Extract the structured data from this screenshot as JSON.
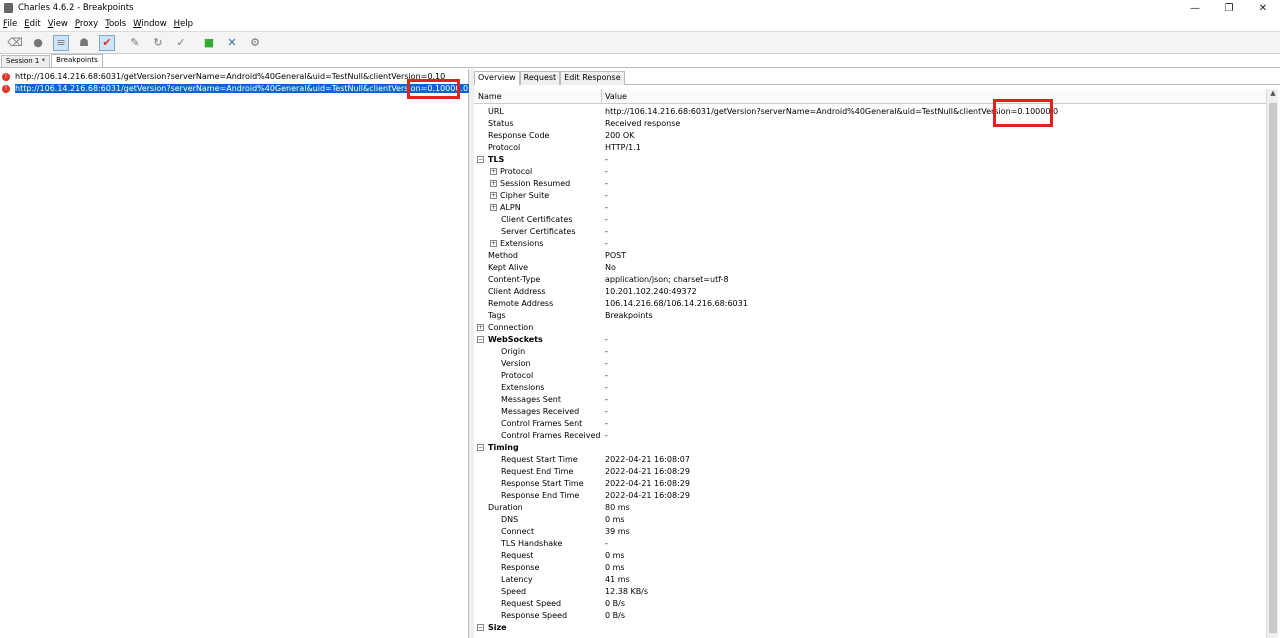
{
  "window": {
    "title": "Charles 4.6.2 - Breakpoints",
    "minimize": "—",
    "restore": "❐",
    "close": "✕"
  },
  "menu": [
    "File",
    "Edit",
    "View",
    "Proxy",
    "Tools",
    "Window",
    "Help"
  ],
  "menu_access": [
    "F",
    "E",
    "V",
    "P",
    "T",
    "W",
    "H"
  ],
  "session_tabs": [
    "Session 1 *",
    "Breakpoints"
  ],
  "requests": [
    {
      "url": "http://106.14.216.68:6031/getVersion?serverName=Android%40General&uid=TestNull&clientVersion=",
      "version": "0.10"
    },
    {
      "url": "http://106.14.216.68:6031/getVersion?serverName=Android%40General&uid=TestNull&clientVersion=",
      "version": "0.10000.0"
    }
  ],
  "detail_tabs": [
    "Overview",
    "Request",
    "Edit Response"
  ],
  "columns": {
    "name": "Name",
    "value": "Value"
  },
  "overview_url": {
    "prefix": "http://106.14.216.68:6031/getVersion?serverName=Android%40General&uid=TestNull&clientVersion=",
    "version": "0.10000.0"
  },
  "rows": [
    {
      "n": "URL",
      "v": ""
    },
    {
      "n": "Status",
      "v": "Received response"
    },
    {
      "n": "Response Code",
      "v": "200 OK"
    },
    {
      "n": "Protocol",
      "v": "HTTP/1.1"
    },
    {
      "n": "TLS",
      "v": "-"
    },
    {
      "n": "Protocol",
      "v": "-"
    },
    {
      "n": "Session Resumed",
      "v": "-"
    },
    {
      "n": "Cipher Suite",
      "v": "-"
    },
    {
      "n": "ALPN",
      "v": "-"
    },
    {
      "n": "Client Certificates",
      "v": "-"
    },
    {
      "n": "Server Certificates",
      "v": "-"
    },
    {
      "n": "Extensions",
      "v": "-"
    },
    {
      "n": "Method",
      "v": "POST"
    },
    {
      "n": "Kept Alive",
      "v": "No"
    },
    {
      "n": "Content-Type",
      "v": "application/json; charset=utf-8"
    },
    {
      "n": "Client Address",
      "v": "10.201.102.240:49372"
    },
    {
      "n": "Remote Address",
      "v": "106.14.216.68/106.14.216.68:6031"
    },
    {
      "n": "Tags",
      "v": "Breakpoints"
    },
    {
      "n": "Connection",
      "v": ""
    },
    {
      "n": "WebSockets",
      "v": "-"
    },
    {
      "n": "Origin",
      "v": "-"
    },
    {
      "n": "Version",
      "v": "-"
    },
    {
      "n": "Protocol",
      "v": "-"
    },
    {
      "n": "Extensions",
      "v": "-"
    },
    {
      "n": "Messages Sent",
      "v": "-"
    },
    {
      "n": "Messages Received",
      "v": "-"
    },
    {
      "n": "Control Frames Sent",
      "v": "-"
    },
    {
      "n": "Control Frames Received",
      "v": "-"
    },
    {
      "n": "Timing",
      "v": ""
    },
    {
      "n": "Request Start Time",
      "v": "2022-04-21 16:08:07"
    },
    {
      "n": "Request End Time",
      "v": "2022-04-21 16:08:29"
    },
    {
      "n": "Response Start Time",
      "v": "2022-04-21 16:08:29"
    },
    {
      "n": "Response End Time",
      "v": "2022-04-21 16:08:29"
    },
    {
      "n": "Duration",
      "v": "80 ms"
    },
    {
      "n": "DNS",
      "v": "0 ms"
    },
    {
      "n": "Connect",
      "v": "39 ms"
    },
    {
      "n": "TLS Handshake",
      "v": "-"
    },
    {
      "n": "Request",
      "v": "0 ms"
    },
    {
      "n": "Response",
      "v": "0 ms"
    },
    {
      "n": "Latency",
      "v": "41 ms"
    },
    {
      "n": "Speed",
      "v": "12.38 KB/s"
    },
    {
      "n": "Request Speed",
      "v": "0 B/s"
    },
    {
      "n": "Response Speed",
      "v": "0 B/s"
    },
    {
      "n": "Size",
      "v": ""
    }
  ],
  "colors": {
    "highlight": "#e3201b",
    "selection": "#0a64d6"
  }
}
